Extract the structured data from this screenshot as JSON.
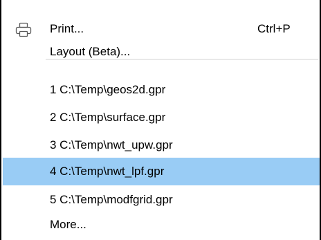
{
  "menu": {
    "print": {
      "label": "Print...",
      "shortcut": "Ctrl+P",
      "icon": "printer-icon"
    },
    "layout": {
      "label": "Layout (Beta)..."
    },
    "recent_files": [
      {
        "label": "1 C:\\Temp\\geos2d.gpr"
      },
      {
        "label": "2 C:\\Temp\\surface.gpr"
      },
      {
        "label": "3 C:\\Temp\\nwt_upw.gpr"
      },
      {
        "label": "4 C:\\Temp\\nwt_lpf.gpr",
        "highlighted": true
      },
      {
        "label": "5 C:\\Temp\\modfgrid.gpr"
      }
    ],
    "more": {
      "label": "More..."
    }
  },
  "colors": {
    "highlight": "#99ccf5",
    "separator": "#d0d0d0",
    "border": "#000000"
  }
}
